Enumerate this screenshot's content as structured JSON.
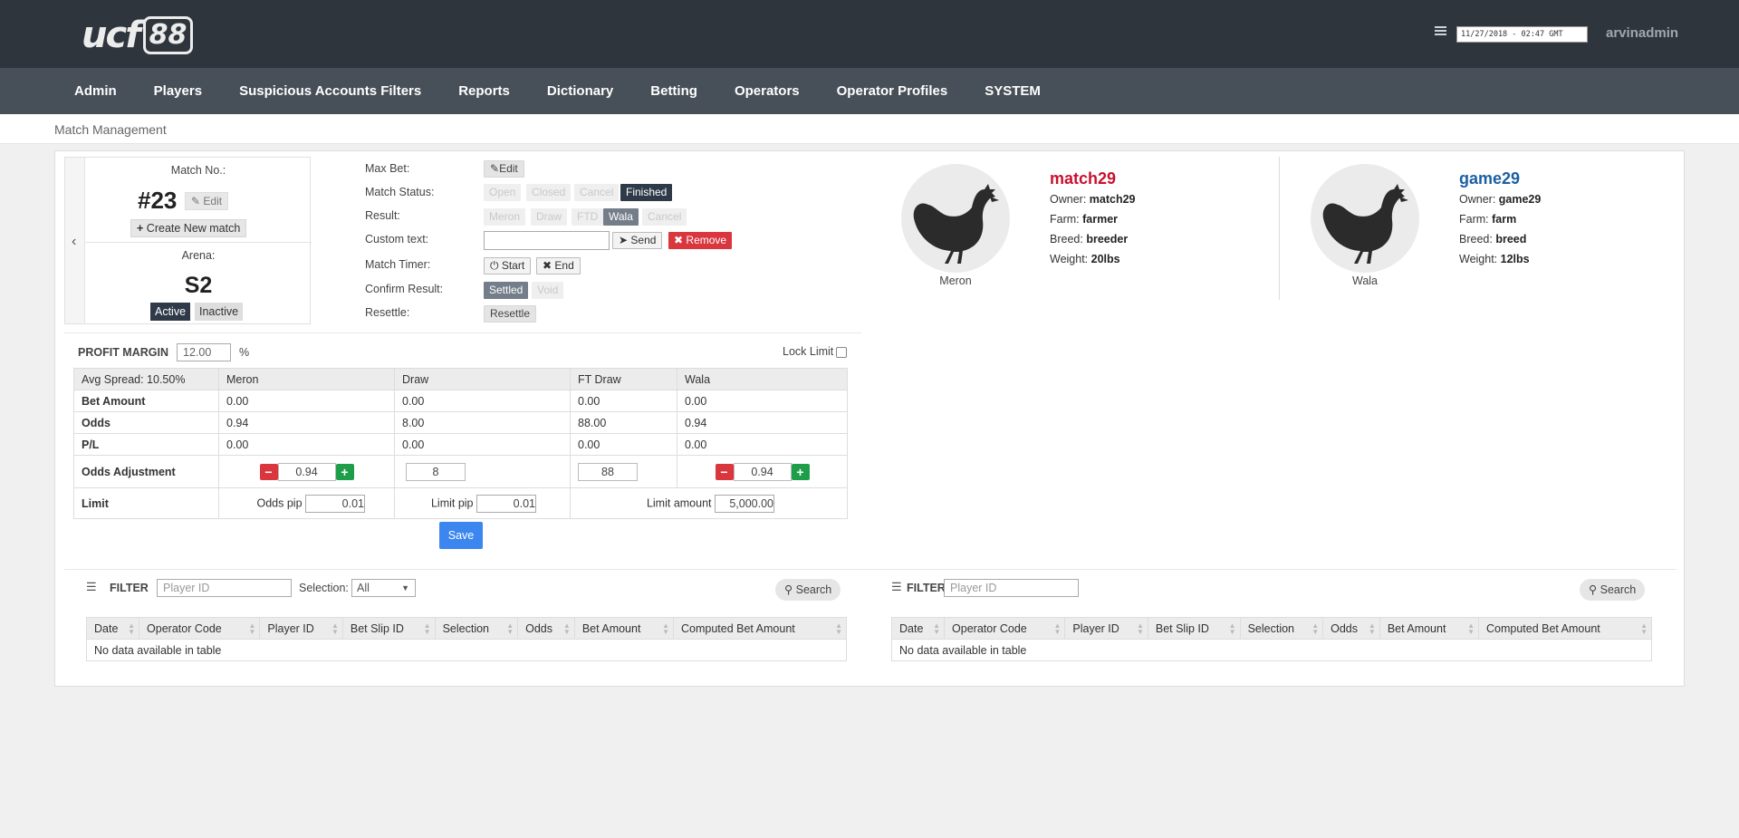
{
  "header": {
    "logo_text": "ucf",
    "logo_number": "88",
    "datetime": "11/27/2018 - 02:47 GMT",
    "username": "arvinadmin"
  },
  "nav": [
    "Admin",
    "Players",
    "Suspicious Accounts Filters",
    "Reports",
    "Dictionary",
    "Betting",
    "Operators",
    "Operator Profiles",
    "SYSTEM"
  ],
  "breadcrumb": "Match Management",
  "match": {
    "no_label": "Match No.:",
    "no_value": "#23",
    "edit_label": "Edit",
    "new_match_label": "Create New match",
    "arena_label": "Arena:",
    "arena_value": "S2",
    "active_label": "Active",
    "inactive_label": "Inactive"
  },
  "controls": {
    "max_bet_label": "Max Bet:",
    "max_bet_edit": "Edit",
    "status_label": "Match Status:",
    "status_open": "Open",
    "status_closed": "Closed",
    "status_cancel": "Cancel",
    "status_finished": "Finished",
    "result_label": "Result:",
    "result_meron": "Meron",
    "result_draw": "Draw",
    "result_ftd": "FTD",
    "result_wala": "Wala",
    "result_cancel": "Cancel",
    "custom_text_label": "Custom text:",
    "send_label": "Send",
    "remove_label": "Remove",
    "timer_label": "Match Timer:",
    "start_label": "Start",
    "end_label": "End",
    "confirm_label": "Confirm Result:",
    "settled_label": "Settled",
    "void_label": "Void",
    "resettle_label": "Resettle:",
    "resettle_btn": "Resettle"
  },
  "fighters": {
    "meron": {
      "caption": "Meron",
      "name": "match29",
      "owner_label": "Owner:",
      "owner": "match29",
      "farm_label": "Farm:",
      "farm": "farmer",
      "breed_label": "Breed:",
      "breed": "breeder",
      "weight_label": "Weight:",
      "weight": "20lbs"
    },
    "wala": {
      "caption": "Wala",
      "name": "game29",
      "owner_label": "Owner:",
      "owner": "game29",
      "farm_label": "Farm:",
      "farm": "farm",
      "breed_label": "Breed:",
      "breed": "breed",
      "weight_label": "Weight:",
      "weight": "12lbs"
    }
  },
  "profit": {
    "label": "PROFIT MARGIN",
    "value": "12.00",
    "unit": "%",
    "lock_label": "Lock Limit"
  },
  "odds_table": {
    "avg_spread": "Avg Spread: 10.50%",
    "columns": [
      "Meron",
      "Draw",
      "FT Draw",
      "Wala"
    ],
    "rows": [
      {
        "label": "Bet Amount",
        "values": [
          "0.00",
          "0.00",
          "0.00",
          "0.00"
        ]
      },
      {
        "label": "Odds",
        "values": [
          "0.94",
          "8.00",
          "88.00",
          "0.94"
        ]
      },
      {
        "label": "P/L",
        "values": [
          "0.00",
          "0.00",
          "0.00",
          "0.00"
        ]
      }
    ],
    "adjust_label": "Odds Adjustment",
    "adjust_values": [
      "0.94",
      "8",
      "88",
      "0.94"
    ],
    "limit_label": "Limit",
    "odds_pip_label": "Odds pip",
    "odds_pip": "0.01",
    "limit_pip_label": "Limit pip",
    "limit_pip": "0.01",
    "limit_amount_label": "Limit amount",
    "limit_amount": "5,000.00",
    "save_label": "Save"
  },
  "filters": {
    "left": {
      "label": "FILTER",
      "player_placeholder": "Player ID",
      "selection_label": "Selection:",
      "selection_value": "All",
      "search_label": "Search"
    },
    "right": {
      "label": "FILTER",
      "player_placeholder": "Player ID",
      "search_label": "Search"
    }
  },
  "bets_table": {
    "columns": [
      "Date",
      "Operator Code",
      "Player ID",
      "Bet Slip ID",
      "Selection",
      "Odds",
      "Bet Amount",
      "Computed Bet Amount"
    ],
    "empty_text": "No data available in table"
  },
  "colors": {
    "meron": "#c8102e",
    "wala": "#1a5fa3",
    "topbar": "#2f353d",
    "navbar": "#474f58"
  }
}
